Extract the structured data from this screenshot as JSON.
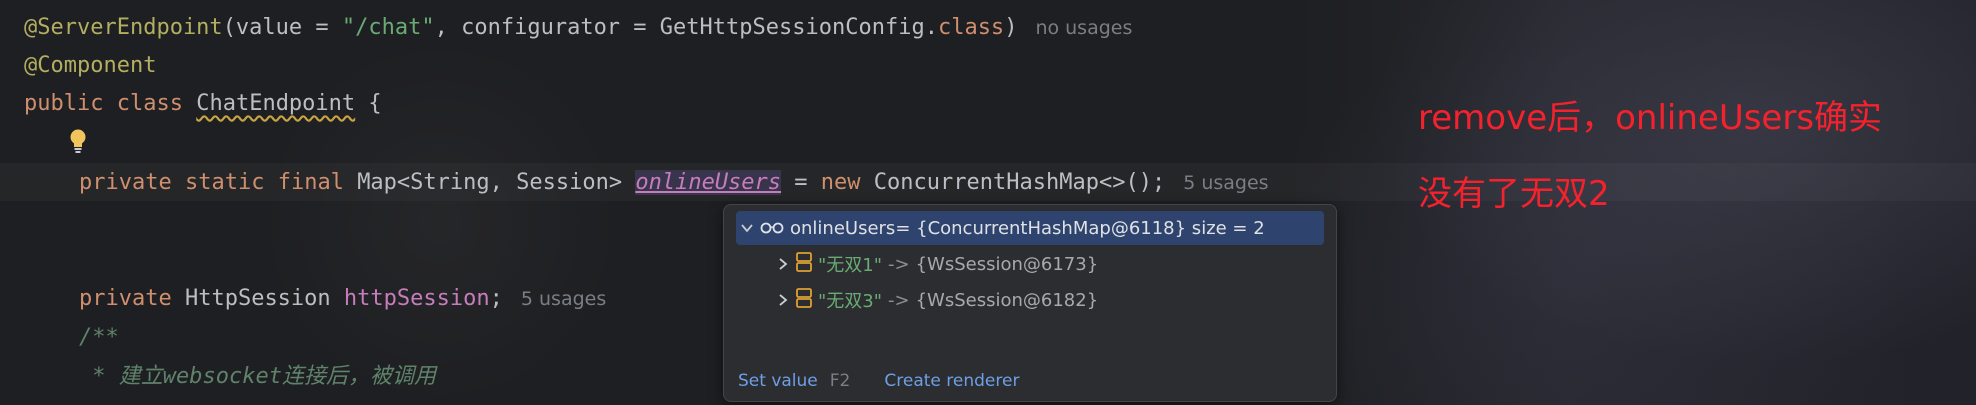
{
  "editor": {
    "line1": {
      "annotation": "@ServerEndpoint",
      "args_open": "(value = ",
      "path": "\"/chat\"",
      "args_mid": ", configurator = GetHttpSessionConfig.",
      "class_kw": "class",
      "args_close": ")",
      "hint": "no usages"
    },
    "line2": {
      "annotation": "@Component"
    },
    "line3": {
      "kw1": "public",
      "kw2": "class",
      "class_name": "ChatEndpoint",
      "brace": " {"
    },
    "line4": {
      "kw1": "private",
      "kw2": "static",
      "kw3": "final",
      "type": "Map<String, Session>",
      "field": "onlineUsers",
      "eq": " = ",
      "new_kw": "new",
      "ctor": "ConcurrentHashMap<>();",
      "hint": "5 usages"
    },
    "line5": {
      "kw1": "private",
      "type": "HttpSession",
      "field": "httpSession",
      "semi": ";",
      "hint": "5 usages"
    },
    "line6": {
      "comment": "/**"
    },
    "line7": {
      "comment": " * 建立websocket连接后，被调用"
    }
  },
  "debug_popup": {
    "root": {
      "name": "onlineUsers",
      "value": " = {ConcurrentHashMap@6118}  size = 2"
    },
    "entries": [
      {
        "key": "\"无双1\"",
        "arrow": "->",
        "value": "{WsSession@6173}"
      },
      {
        "key": "\"无双3\"",
        "arrow": "->",
        "value": "{WsSession@6182}"
      }
    ],
    "set_value_label": "Set value",
    "set_value_shortcut": "F2",
    "create_renderer_label": "Create renderer"
  },
  "annotation_note": {
    "line1": "remove后，onlineUsers确实",
    "line2": "没有了无双2",
    "color": "#f5222d"
  },
  "icons": [
    "lightbulb-icon",
    "watch-glasses-icon",
    "expand-arrow-icon",
    "collapse-arrow-icon",
    "map-entry-icon"
  ]
}
